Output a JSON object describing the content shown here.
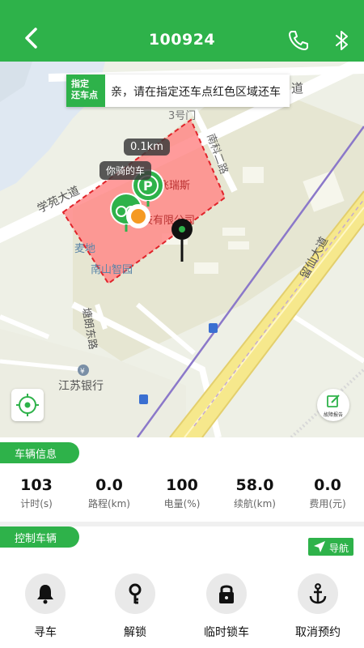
{
  "header": {
    "title": "100924"
  },
  "map": {
    "banner_badge_line1": "指定",
    "banner_badge_line2": "还车点",
    "banner_text": "亲，请在指定还车点红色区域还车",
    "distance_tip": "0.1km",
    "my_bike_tip": "你骑的车",
    "labels": {
      "road_top": "道",
      "gate": "3号门",
      "road_nk": "南科二路",
      "road_xy": "学苑大道",
      "company": "飞瑞斯",
      "company2": "技有限公司",
      "maidi": "麦地",
      "nanshan": "南山智园",
      "tanglang": "塘朗东路",
      "jsbank": "江苏银行",
      "liuxian": "留仙大道"
    },
    "report_label": "故障报告"
  },
  "vehicle_info": {
    "section_title": "车辆信息",
    "stats": [
      {
        "value": "103",
        "label": "计时(s)"
      },
      {
        "value": "0.0",
        "label": "路程(km)"
      },
      {
        "value": "100",
        "label": "电量(%)"
      },
      {
        "value": "58.0",
        "label": "续航(km)"
      },
      {
        "value": "0.0",
        "label": "费用(元)"
      }
    ]
  },
  "control": {
    "section_title": "控制车辆",
    "nav_label": "导航",
    "buttons": [
      {
        "label": "寻车",
        "icon": "bell-icon"
      },
      {
        "label": "解锁",
        "icon": "key-icon"
      },
      {
        "label": "临时锁车",
        "icon": "lock-icon"
      },
      {
        "label": "取消预约",
        "icon": "anchor-icon"
      }
    ]
  },
  "colors": {
    "primary": "#2eb24a",
    "zone_fill": "#ff8a8a",
    "zone_border": "#e0242a"
  }
}
